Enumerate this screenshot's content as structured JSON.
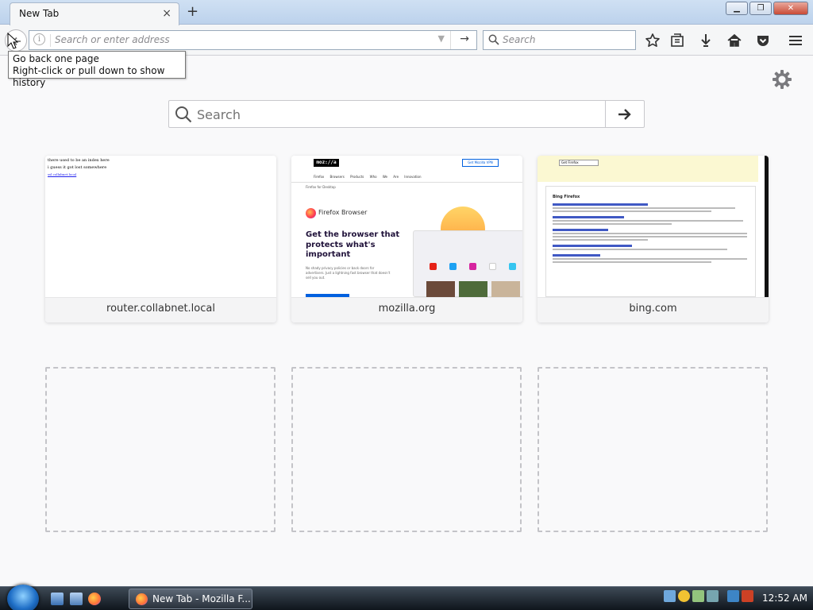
{
  "tab": {
    "title": "New Tab",
    "close": "×",
    "new_tab": "+"
  },
  "window_controls": {
    "minimize": "▁",
    "maximize": "❐",
    "close": "✕"
  },
  "urlbar": {
    "placeholder": "Search or enter address",
    "info": "i",
    "dropdown": "▼",
    "go": "→"
  },
  "searchbar": {
    "placeholder": "Search"
  },
  "tooltip": {
    "line1": "Go back one page",
    "line2": "Right-click or pull down to show history"
  },
  "content_search": {
    "placeholder": "Search"
  },
  "top_sites": [
    {
      "label": "router.collabnet.local",
      "thumb_lines": [
        "there used to be an index here",
        "i guess it got lost somewhere",
        "ssl.collabnet.local"
      ]
    },
    {
      "label": "mozilla.org",
      "logo": "moz://a",
      "vpn": "Get Mozilla VPN",
      "nav": "Firefox Browsers  Products  Who We Are  Innovation",
      "sub": "Firefox for Desktop",
      "product": "Firefox Browser",
      "headline": "Get the browser that protects what's important",
      "body": "No shady privacy policies or back doors for advertisers. Just a lightning fast browser that doesn't sell you out."
    },
    {
      "label": "bing.com",
      "search_value": "Get Firefox",
      "heading": "Bing Firefox"
    }
  ],
  "taskbar": {
    "button_label": "New Tab - Mozilla F...",
    "clock": "12:52 AM"
  },
  "colors": {
    "accent": "#0060df",
    "content_bg": "#f9f9fa",
    "taskbar": "#1a222b"
  }
}
